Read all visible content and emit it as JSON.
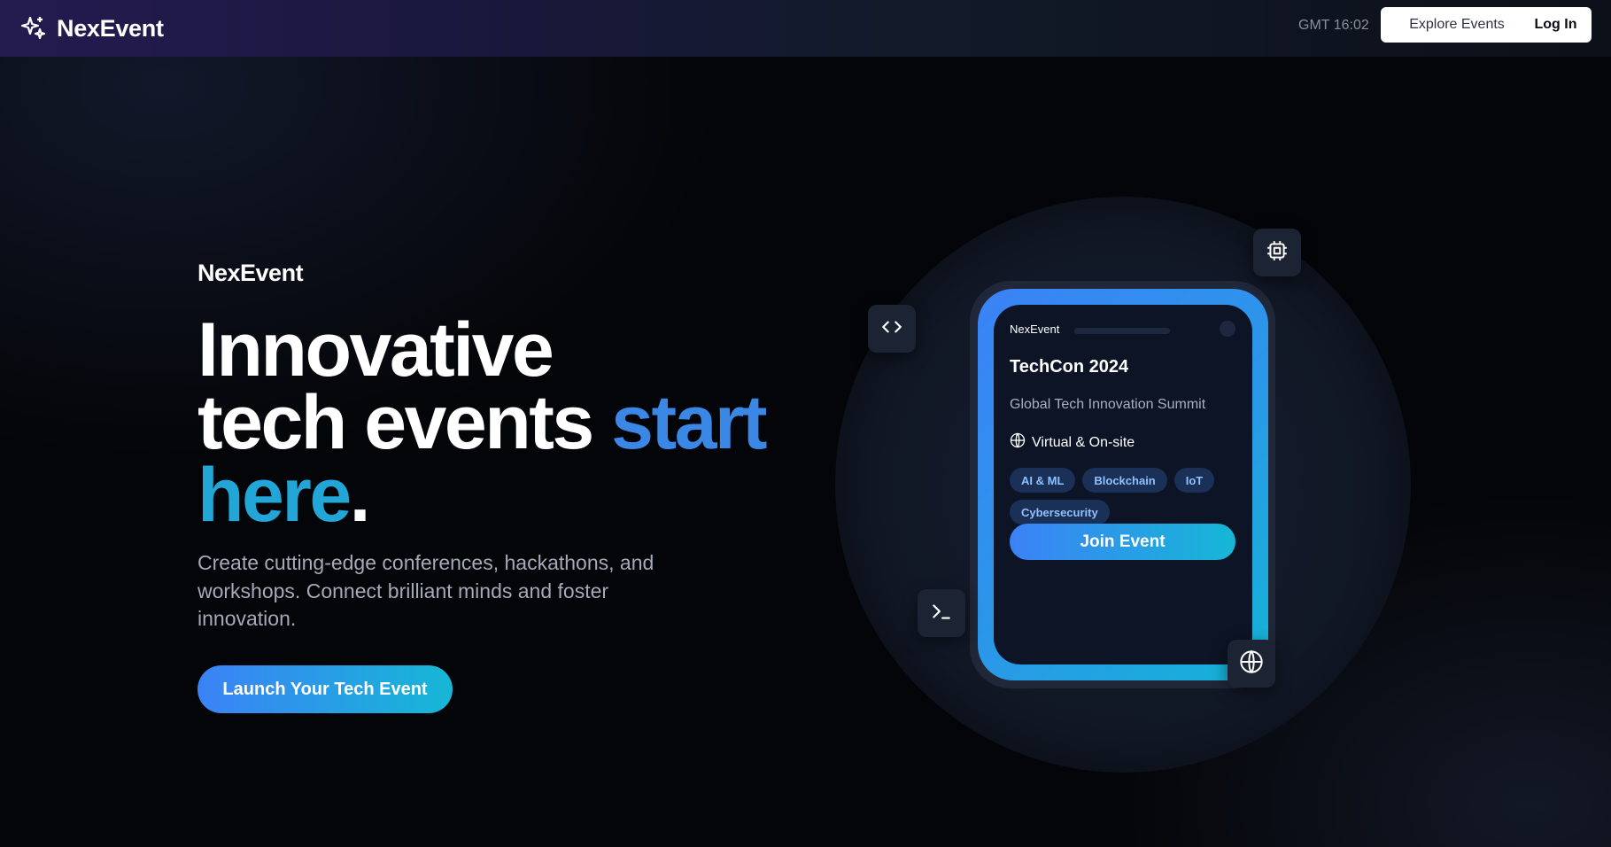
{
  "header": {
    "brand": "NexEvent",
    "clock": "GMT 16:02",
    "explore_label": "Explore Events",
    "login_label": "Log In"
  },
  "hero": {
    "brand": "NexEvent",
    "headline_line1": "Innovative",
    "headline_line2": "tech events",
    "headline_accent1": "start",
    "headline_accent2": "here",
    "headline_period": ".",
    "description": "Create cutting-edge conferences, hackathons, and workshops. Connect brilliant minds and foster innovation.",
    "cta_label": "Launch Your Tech Event"
  },
  "card": {
    "brand": "NexEvent",
    "title": "TechCon 2024",
    "subtitle": "Global Tech Innovation Summit",
    "mode": "Virtual & On-site",
    "tags": [
      "AI & ML",
      "Blockchain",
      "IoT",
      "Cybersecurity"
    ],
    "join_label": "Join Event"
  },
  "icons": {
    "logo": "sparkles-icon",
    "code": "code-icon",
    "chip": "cpu-chip-icon",
    "terminal": "terminal-icon",
    "globe": "globe-icon"
  },
  "colors": {
    "accent_blue": "#3b82f6",
    "accent_cyan": "#16b7d6",
    "tag_bg": "#1b3056",
    "tag_text": "#8fc1ff"
  }
}
